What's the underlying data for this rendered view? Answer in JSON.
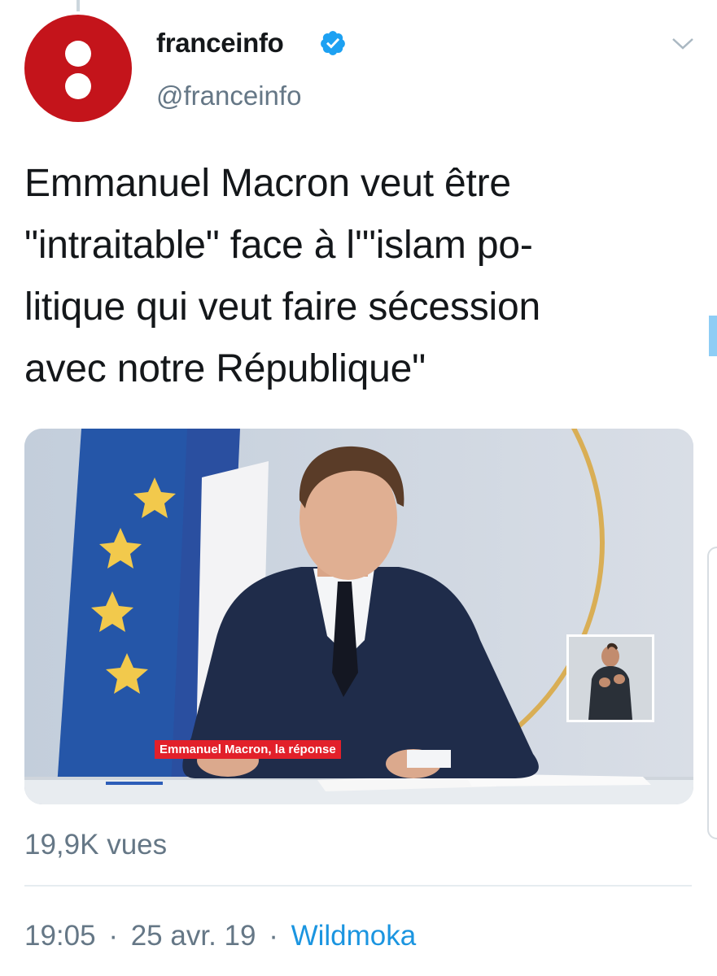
{
  "account": {
    "name": "franceinfo",
    "handle": "@franceinfo",
    "verified": true,
    "avatar_color": "#c4141b"
  },
  "tweet": {
    "text_lines": [
      "Emmanuel Macron veut être",
      "\"intraitable\" face à l'\"islam po-",
      "litique qui veut faire sécession",
      "avec notre République\""
    ]
  },
  "media": {
    "type": "video",
    "caption_banner": "Emmanuel Macron, la réponse"
  },
  "stats": {
    "views": "19,9K vues"
  },
  "meta": {
    "time": "19:05",
    "date": "25 avr. 19",
    "separator": "·",
    "source": "Wildmoka"
  },
  "colors": {
    "text": "#14171a",
    "secondary": "#657786",
    "link": "#1b95e0",
    "verified": "#1da1f2",
    "divider": "#e6ecf0"
  },
  "icons": {
    "verified": "verified-badge-icon",
    "menu": "chevron-down-icon"
  }
}
